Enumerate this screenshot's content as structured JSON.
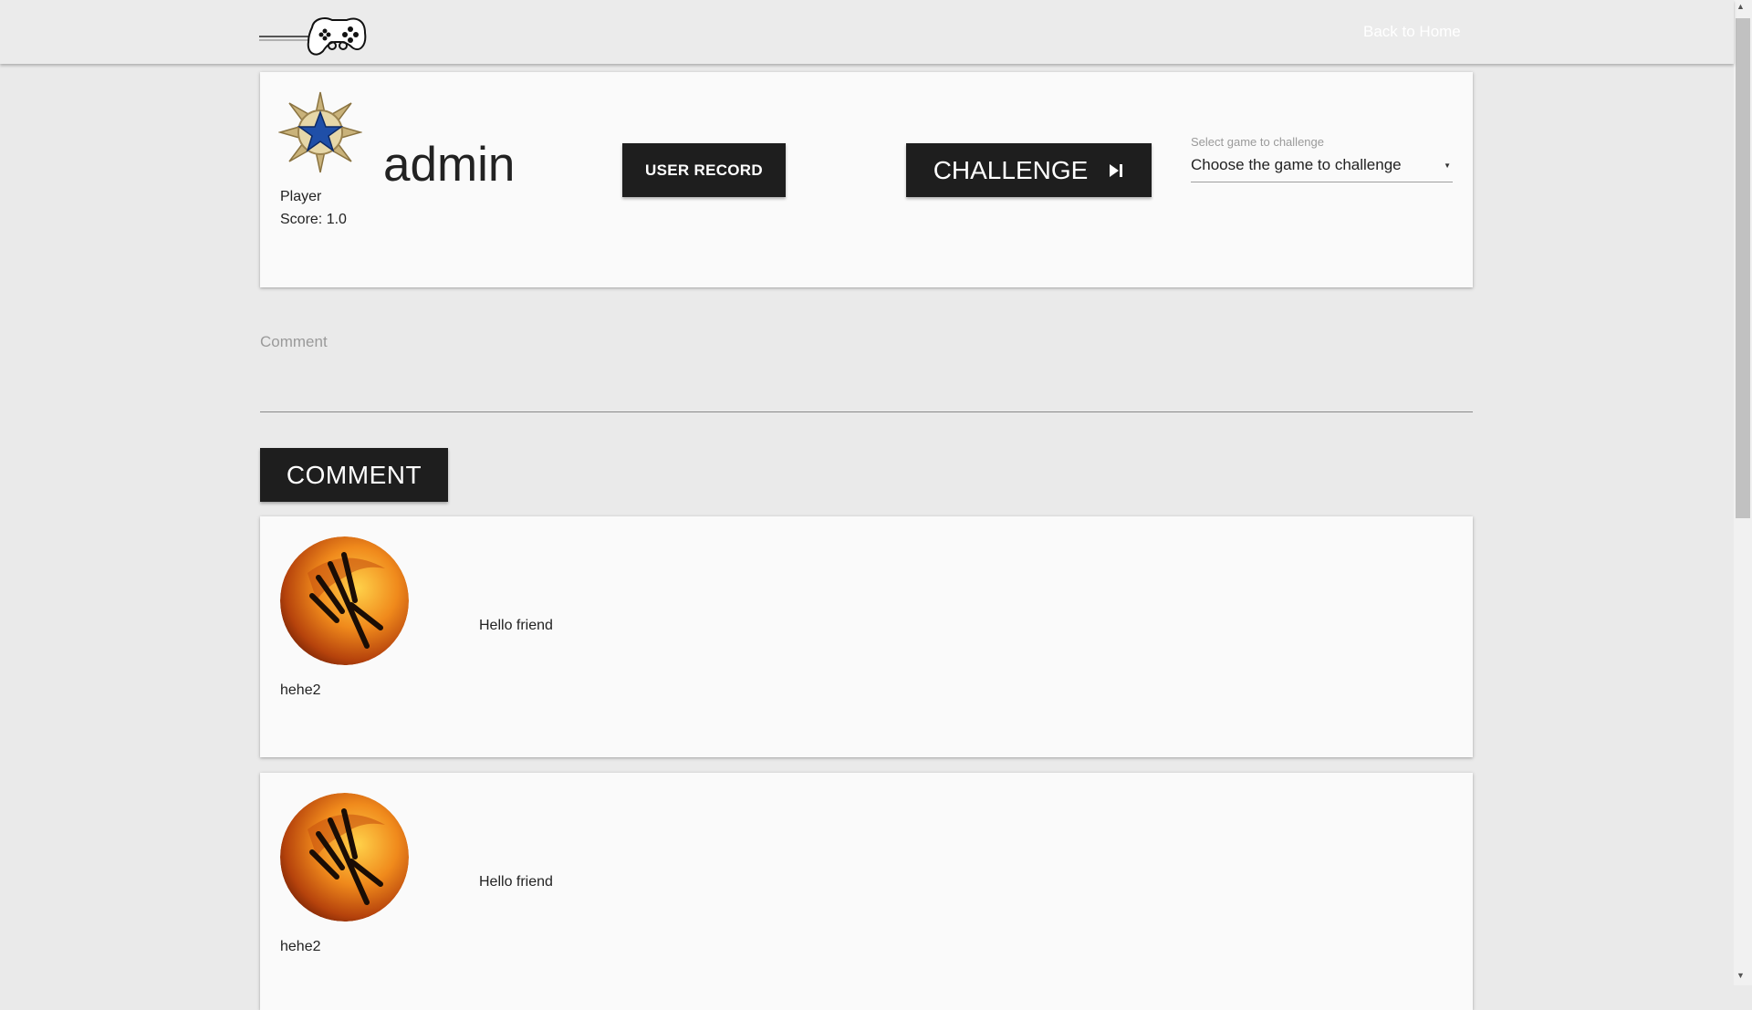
{
  "navbar": {
    "logo_icon": "gamepad-logo-icon",
    "back_home_label": "Back to Home"
  },
  "profile": {
    "rank_icon": "blue-star-rank-badge-icon",
    "role": "Player",
    "score_text": "Score: 1.0",
    "username": "admin",
    "user_record_label": "USER RECORD",
    "challenge_label": "CHALLENGE",
    "challenge_icon": "skip-next-icon",
    "select": {
      "label": "Select game to challenge",
      "value": "Choose the game to challenge",
      "caret_icon": "dropdown-caret-icon"
    }
  },
  "comment_form": {
    "placeholder": "Comment",
    "submit_label": "COMMENT"
  },
  "comments": [
    {
      "author": "hehe2",
      "text": "Hello friend",
      "avatar_icon": "fire-claw-avatar"
    },
    {
      "author": "hehe2",
      "text": "Hello friend",
      "avatar_icon": "fire-claw-avatar"
    }
  ],
  "colors": {
    "page_bg": "#eaeaea",
    "card_bg": "#fafafa",
    "button_bg": "#1e1e1e",
    "button_text": "#ffffff"
  }
}
